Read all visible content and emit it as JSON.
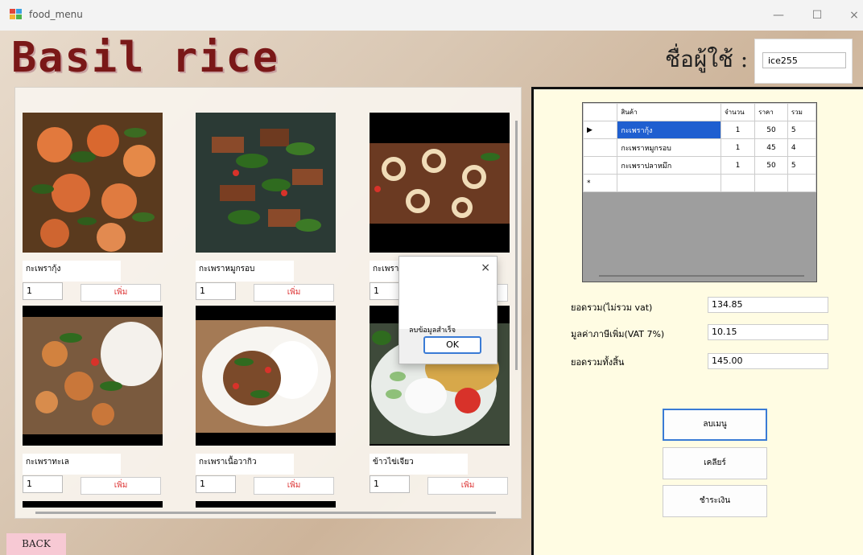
{
  "window": {
    "title": "food_menu",
    "minimize": "—",
    "maximize": "☐",
    "close": "×"
  },
  "header": {
    "app_title": "Basil rice",
    "user_label": "ชื่อผู้ใช้ :",
    "username": "ice255"
  },
  "menu": {
    "add_label": "เพิ่ม",
    "items": [
      {
        "name": "กะเพรากุ้ง",
        "qty": "1",
        "image": "shrimp-basil"
      },
      {
        "name": "กะเพราหมูกรอบ",
        "qty": "1",
        "image": "crispy-pork-basil"
      },
      {
        "name": "กะเพรา",
        "qty": "1",
        "image": "squid-basil"
      },
      {
        "name": "กะเพราทะเล",
        "qty": "1",
        "image": "seafood-basil-rice"
      },
      {
        "name": "กะเพราเนื้อวากิว",
        "qty": "1",
        "image": "wagyu-basil-rice"
      },
      {
        "name": "ข้าวไข่เจียว",
        "qty": "1",
        "image": "omelet-rice"
      }
    ]
  },
  "dialog": {
    "close": "×",
    "message": "ลบข้อมูลสำเร็จ",
    "ok": "OK"
  },
  "order_grid": {
    "columns": [
      "สินค้า",
      "จำนวน",
      "ราคา",
      "รวม"
    ],
    "rows": [
      {
        "marker": "▶",
        "product": "กะเพรากุ้ง",
        "qty": "1",
        "price": "50",
        "total": "5"
      },
      {
        "marker": "",
        "product": "กะเพราหมูกรอบ",
        "qty": "1",
        "price": "45",
        "total": "4"
      },
      {
        "marker": "",
        "product": "กะเพราปลาหมึก",
        "qty": "1",
        "price": "50",
        "total": "5"
      },
      {
        "marker": "*",
        "product": "",
        "qty": "",
        "price": "",
        "total": ""
      }
    ]
  },
  "totals": {
    "subtotal_label": "ยอดรวม(ไม่รวม vat)",
    "subtotal": "134.85",
    "vat_label": "มูลค่าภาษีเพิ่ม(VAT 7%)",
    "vat": "10.15",
    "grand_label": "ยอดรวมทั้งสิ้น",
    "grand": "145.00"
  },
  "actions": {
    "delete": "ลบเมนู",
    "clear": "เคลียร์",
    "pay": "ชำระเงิน"
  },
  "back": "BACK",
  "colors": {
    "title": "#7a1818",
    "selection": "#1f5fd0",
    "right_panel": "#fffce3",
    "back_button": "#f7c9d4"
  }
}
